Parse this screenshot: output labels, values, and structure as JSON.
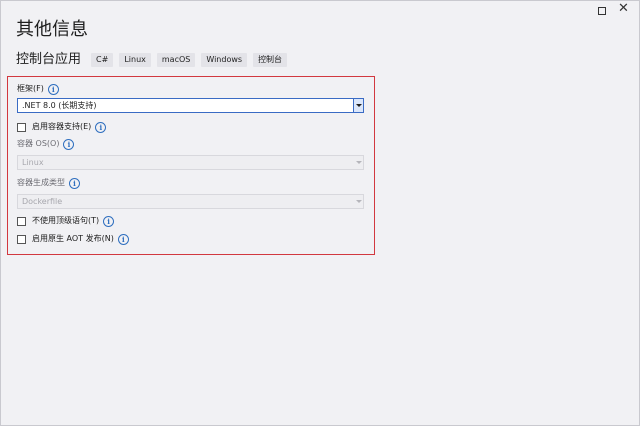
{
  "window": {
    "maximize_label": "maximize",
    "close_glyph": "✕"
  },
  "page_title": "其他信息",
  "template": {
    "name": "控制台应用",
    "tags": [
      "C#",
      "Linux",
      "macOS",
      "Windows",
      "控制台"
    ]
  },
  "form": {
    "framework": {
      "label": "框架(F)",
      "value": ".NET 8.0 (长期支持)"
    },
    "container_support": {
      "label": "启用容器支持(E)",
      "checked": false
    },
    "container_os": {
      "label": "容器 OS(O)",
      "value": "Linux",
      "disabled": true
    },
    "container_build_type": {
      "label": "容器生成类型",
      "value": "Dockerfile",
      "disabled": true
    },
    "no_top_level_statements": {
      "label": "不使用顶级语句(T)",
      "checked": false
    },
    "native_aot": {
      "label": "启用原生 AOT 发布(N)",
      "checked": false
    }
  },
  "info_icon": "i",
  "colors": {
    "highlight_border": "#d2383f",
    "info_blue": "#2f6fbf",
    "select_focus": "#3a6bc4"
  }
}
